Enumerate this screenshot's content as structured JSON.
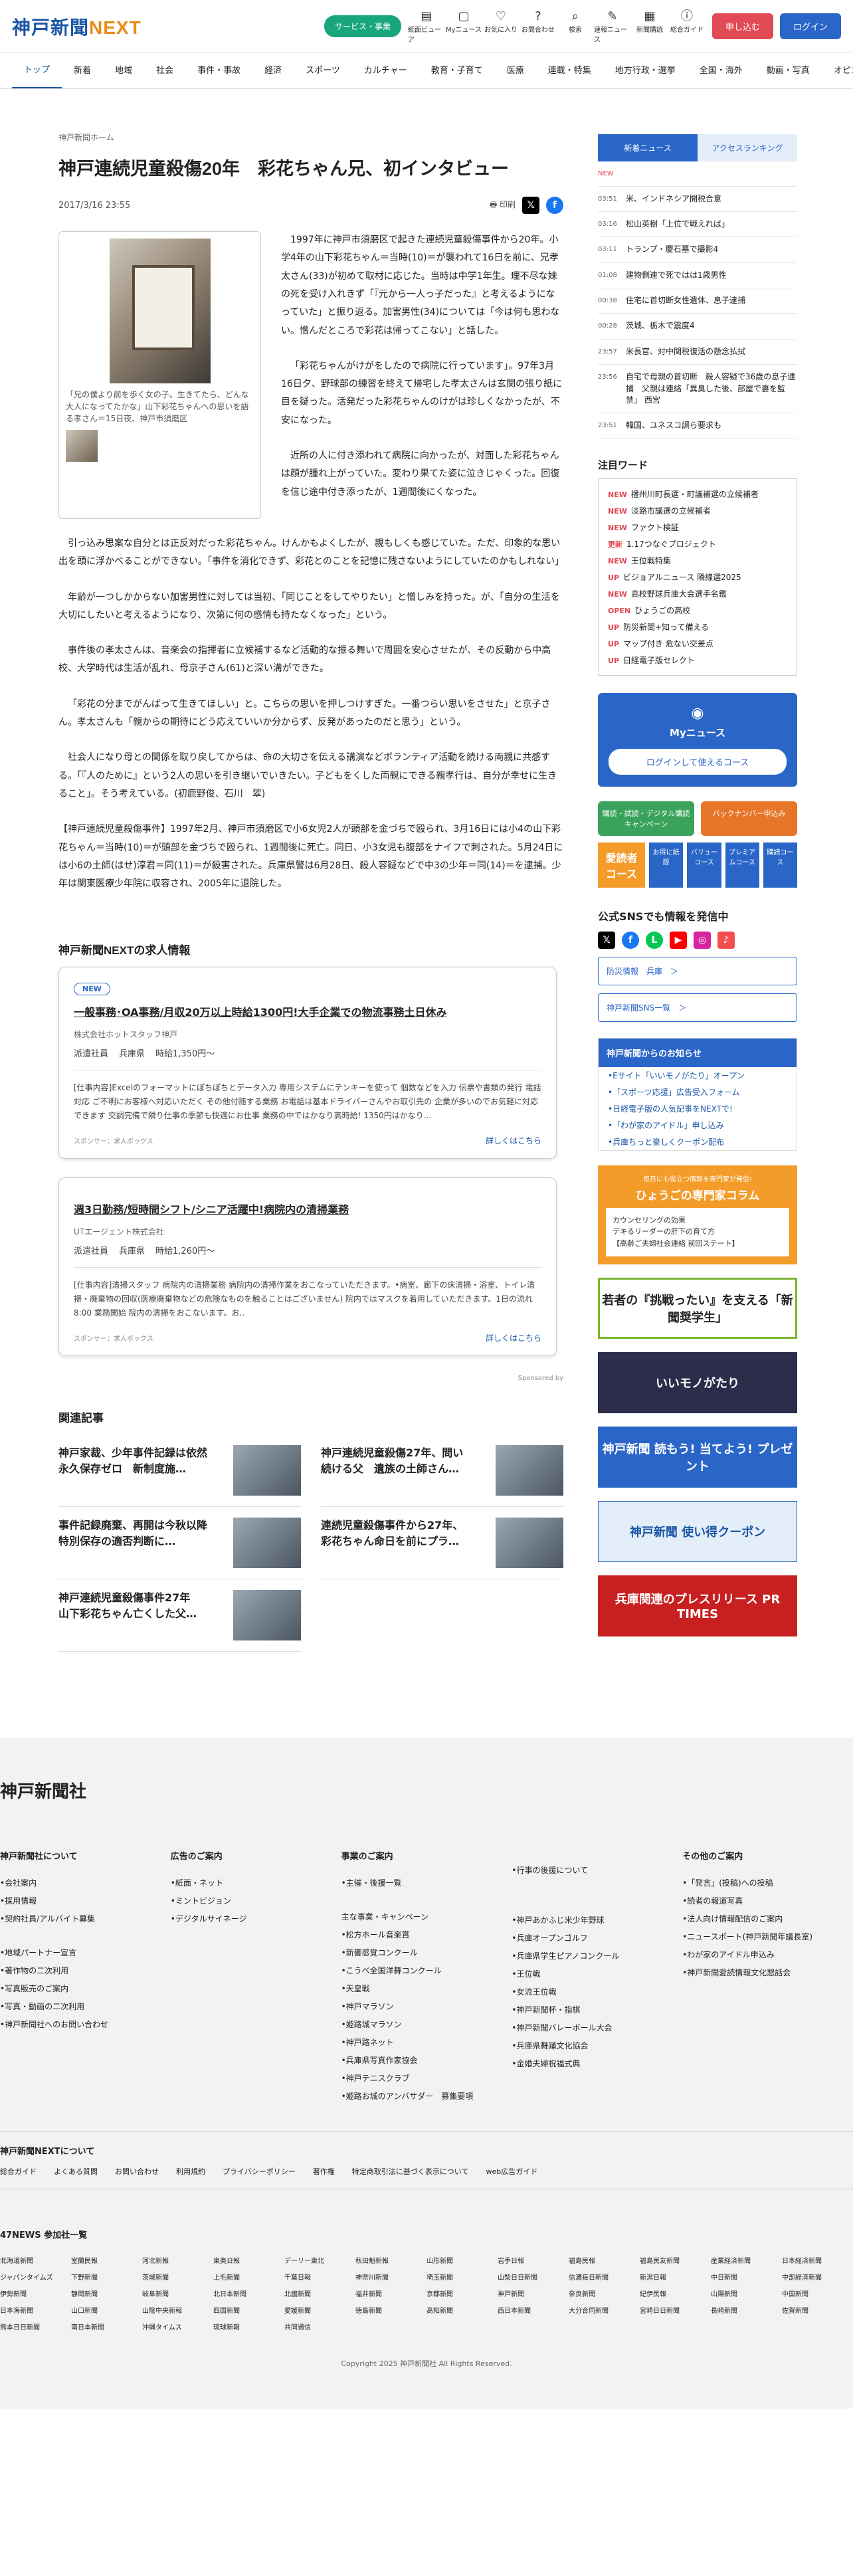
{
  "header": {
    "logo_main": "神戸新聞",
    "logo_sub": "NEXT",
    "service_btn": "サービス・事業",
    "icons": [
      {
        "label": "紙面ビューア",
        "icon": "newspaper-icon"
      },
      {
        "label": "Myニュース",
        "icon": "bookmark-icon"
      },
      {
        "label": "お気に入り",
        "icon": "heart-icon"
      },
      {
        "label": "お問合わせ",
        "icon": "help-icon"
      },
      {
        "label": "検索",
        "icon": "search-icon"
      },
      {
        "label": "速報ニュース",
        "icon": "pen-icon"
      },
      {
        "label": "新聞購読",
        "icon": "cart-icon"
      },
      {
        "label": "総合ガイド",
        "icon": "info-icon"
      }
    ],
    "signup": "申し込む",
    "login": "ログイン"
  },
  "nav": [
    "トップ",
    "新着",
    "地域",
    "社会",
    "事件・事故",
    "経済",
    "スポーツ",
    "カルチャー",
    "教育・子育て",
    "医療",
    "連載・特集",
    "地方行政・選挙",
    "全国・海外",
    "動画・写真",
    "オピニオン"
  ],
  "breadcrumb": "神戸新聞ホーム",
  "article": {
    "title": "神戸連続児童殺傷20年　彩花ちゃん兄、初インタビュー",
    "date": "2017/3/16 23:55",
    "print": "印刷",
    "caption": "「兄の僕より前を歩く女の子。生きてたら、どんな大人になってたかな」山下彩花ちゃんへの思いを語る孝さん＝15日夜、神戸市須磨区",
    "p1": "1997年に神戸市須磨区で起きた連続児童殺傷事件から20年。小学4年の山下彩花ちゃん＝当時(10)＝が襲われて16日を前に、兄孝太さん(33)が初めて取材に応じた。当時は中学1年生。理不尽な妹の死を受け入れきず「『元から一人っ子だった』と考えるようになっていた」と振り返る。加害男性(34)については「今は何も思わない。憎んだところで彩花は帰ってこない」と話した。",
    "p2": "「彩花ちゃんがけがをしたので病院に行っています」。97年3月16日夕、野球部の練習を終えて帰宅した孝太さんは玄関の張り紙に目を疑った。活発だった彩花ちゃんのけがは珍しくなかったが、不安になった。",
    "p3": "近所の人に付き添われて病院に向かったが、対面した彩花ちゃんは顔が腫れ上がっていた。変わり果てた姿に泣きじゃくった。回復を信じ途中付き添ったが、1週間後にくなった。",
    "p4": "引っ込み思案な自分とは正反対だった彩花ちゃん。けんかもよくしたが、親もしくも感じていた。ただ、印象的な思い出を頭に浮かべることができない。「事件を消化できず、彩花とのことを記憶に残さないようにしていたのかもしれない」",
    "p5": "年齢が一つしかからない加害男性に対しては当初、「同じことをしてやりたい」と憎しみを持った。が、「自分の生活を大切にしたいと考えるようになり、次第に何の感情も持たなくなった」という。",
    "p6": "事件後の孝太さんは、音楽会の指揮者に立候補するなど活動的な振る舞いで周囲を安心させたが、その反動から中高校、大学時代は生活が乱れ、母京子さん(61)と深い溝ができた。",
    "p7": "「彩花の分までがんばって生きてほしい」と。こちらの思いを押しつけすぎた。一番つらい思いをさせた」と京子さん。孝太さんも「親からの期待にどう応えていいか分からず、反発があったのだと思う」という。",
    "p8": "社会人になり母との関係を取り戻してからは、命の大切さを伝える講演などボランティア活動を続ける両親に共感する。「『人のために』という2人の思いを引き継いでいきたい。子どもをくした両親にできる親孝行は、自分が幸せに生きること」。そう考えている。(初鹿野俊、石川　翠)",
    "p9": "【神戸連続児童殺傷事件】1997年2月、神戸市須磨区で小6女児2人が頭部を金づちで殴られ、3月16日には小4の山下彩花ちゃん＝当時(10)＝が頭部を金づちで殴られ、1週間後に死亡。同日、小3女児も腹部をナイフで刺された。5月24日には小6の土師(はせ)淳君＝同(11)＝が殺害された。兵庫県警は6月28日、殺人容疑などで中3の少年＝同(14)＝を逮捕。少年は関東医療少年院に収容され、2005年に退院した。"
  },
  "jobs": {
    "heading": "神戸新聞NEXTの求人情報",
    "items": [
      {
        "badge": "NEW",
        "title": "一般事務･OA事務/月収20万以上時給1300円!大手企業での物流事務土日休み",
        "company": "株式会社ホットスタッフ神戸",
        "type": "派遣社員",
        "area": "兵庫県",
        "pay": "時給1,350円〜",
        "desc": "[仕事内容]Excelのフォーマットにぽちぽちとデータ入力 専用システムにテンキーを使って 個数などを入力 伝票や書類の発行 電話対応 ご不明にお客様へ対応いただく その他付随する業務 お電話は基本ドライバーさんやお取引先の 企業が多いのでお気軽に対応できます 交調完備で隣り仕事の季節も快適にお仕事 業務の中ではかなり高時給! 1350円はかなり...",
        "sponsor": "スポンサー：求人ボックス",
        "more": "詳しくはこちら"
      },
      {
        "badge": "",
        "title": "週3日勤務/短時間シフト/シニア活躍中!病院内の清掃業務",
        "company": "UTエージェント株式会社",
        "type": "派遣社員",
        "area": "兵庫県",
        "pay": "時給1,260円〜",
        "desc": "[仕事内容]清掃スタッフ 病院内の清掃業務 病院内の清掃作業をおこなっていただきます。•病室、廊下の床清掃・浴室、トイレ清掃・廃棄物の回収(医療廃棄物などの危険なものを触ることはございません) 院内ではマスクを着用していただきます。1日の流れ 8:00 業務開始 院内の清掃をおこないます。お..",
        "sponsor": "スポンサー：求人ボックス",
        "more": "詳しくはこちら"
      }
    ],
    "sponsored": "Sponsored by"
  },
  "related": {
    "heading": "関連記事",
    "items": [
      "神戸家裁、少年事件記録は依然永久保存ゼロ　新制度施…",
      "神戸連続児童殺傷27年、問い続ける父　遺族の土師さん…",
      "事件記録廃棄、再開は今秋以降　特別保存の適否判断に…",
      "連続児童殺傷事件から27年、彩花ちゃん命日を前にプラ…",
      "神戸連続児童殺傷事件27年　山下彩花ちゃん亡くした父…"
    ]
  },
  "sidebar": {
    "tab_new": "新着ニュース",
    "tab_rank": "アクセスランキング",
    "news": [
      {
        "time": "NEW",
        "text": ""
      },
      {
        "time": "03:51",
        "text": "米、インドネシア開税合意"
      },
      {
        "time": "03:16",
        "text": "松山英樹「上位で戦えれば」"
      },
      {
        "time": "03:11",
        "text": "トランプ・慶石墓で撮影4"
      },
      {
        "time": "01:08",
        "text": "建物側連で死ではは1歳男性"
      },
      {
        "time": "00:38",
        "text": "住宅に首切断女性遺体、息子逮捕"
      },
      {
        "time": "00:28",
        "text": "茨城、栃木で震度4"
      },
      {
        "time": "23:57",
        "text": "米長官、対中関税復活の懸念払拭"
      },
      {
        "time": "23:56",
        "text": "自宅で母親の首切断　殺人容疑で36歳の息子逮捕　父親は連絡「異臭した後、部屋で妻を監禁」 西宮"
      },
      {
        "time": "23:51",
        "text": "韓国、ユネスコ調ら要求も"
      }
    ],
    "attn_heading": "注目ワード",
    "attn": [
      {
        "k": "NEW",
        "t": "播州川町長選・町議補選の立候補者"
      },
      {
        "k": "NEW",
        "t": "淡路市議選の立候補者"
      },
      {
        "k": "NEW",
        "t": "ファクト検証"
      },
      {
        "k": "更新",
        "t": "1.17つなぐプロジェクト"
      },
      {
        "k": "NEW",
        "t": "王位戦特集"
      },
      {
        "k": "UP",
        "t": "ビジョアルニュース 隣線選2025"
      },
      {
        "k": "NEW",
        "t": "高校野球兵庫大会選手名鑑"
      },
      {
        "k": "OPEN",
        "t": "ひょうごの高校"
      },
      {
        "k": "UP",
        "t": "防災新聞+知って備える"
      },
      {
        "k": "UP",
        "t": "マップ付き 危ない交差点"
      },
      {
        "k": "UP",
        "t": "日経電子版セレクト"
      }
    ],
    "my_title": "Myニュース",
    "my_btn": "ログインして使えるコース",
    "pill1": "購読・試読・デジタル購読キャンペーン",
    "pill2": "バックナンバー申込み",
    "digital": "デジタル",
    "digi_o": "愛読者コース",
    "digi_b": [
      "お得に紙版",
      "バリューコース",
      "プレミアムコース",
      "購読コース"
    ],
    "sns_heading": "公式SNSでも情報を発信中",
    "sns_link1": "防災情報　兵庫　＞",
    "sns_link2": "神戸新聞SNS一覧　＞",
    "info_heading": "神戸新聞からのお知らせ",
    "info": [
      "•Eサイト「いいモノがたり」オープン",
      "•「スポーツ応援」広告受入フォーム",
      "•日経電子版の人気記事をNEXTで!",
      "•「わが家のアイドル」申し込み",
      "•兵庫ちっと豪しくクーポン配布"
    ],
    "col_title": "ひょうごの専門家コラム",
    "col_sub": "毎日にも役立つ情報を専門家が発信!",
    "col_items": [
      "カウンセリングの効果",
      "デキるリーダーの肝下の育て方",
      "【高齢ご夫婦社会連絡 前回ステート】"
    ],
    "banners": [
      "若者の『挑戦ったい』を支える「新聞奨学生」",
      "いいモノがたり",
      "神戸新聞 読もう! 当てよう! プレゼント",
      "神戸新聞 使い得クーポン",
      "兵庫関連のプレスリリース PR TIMES"
    ]
  },
  "footer": {
    "logo": "神戸新聞社",
    "cols": [
      {
        "h": "神戸新聞社について",
        "items": [
          "•会社案内",
          "•採用情報",
          "•契約社員/アルバイト募集",
          "",
          "•地域パートナー宣言",
          "•著作物の二次利用",
          "•写真販売のご案内",
          "•写真・動画の二次利用",
          "•神戸新聞社へのお問い合わせ"
        ]
      },
      {
        "h": "広告のご案内",
        "items": [
          "•紙面・ネット",
          "•ミントビジョン",
          "•デジタルサイネージ"
        ]
      },
      {
        "h": "事業のご案内",
        "items": [
          "•主催・後援一覧",
          "",
          "主な事業・キャンペーン",
          "•松方ホール音楽賞",
          "•新響感覚コンクール",
          "•こうべ全国洋舞コンクール",
          "•天皇戦",
          "•神戸マラソン",
          "•姫路城マラソン",
          "•神戸路ネット",
          "•兵庫県写真作家協会",
          "•神戸テニスクラブ",
          "•姫路お城のアンバサダー　募集要項"
        ]
      },
      {
        "h": "",
        "items": [
          "•行事の後援について",
          "",
          "",
          "•神戸あかふじ米少年野球",
          "•兵庫オープンゴルフ",
          "•兵庫県学生ピアノコンクール",
          "•王位戦",
          "•女流王位戦",
          "•神戸新聞杯・指棋",
          "•神戸新聞バレーボール大会",
          "•兵庫県舞踊文化協会",
          "•金婚夫婦祝福式典"
        ]
      },
      {
        "h": "その他のご案内",
        "items": [
          "•「発言」(投稿)への投稿",
          "•読者の報道写真",
          "•法人向け情報配信のご案内",
          "•ニュースポート(神戸新聞年議長室)",
          "•わが家のアイドル申込み",
          "•神戸新聞愛読情報文化懇話会"
        ]
      }
    ],
    "next_about": "神戸新聞NEXTについて",
    "links": [
      "総合ガイド",
      "よくある質問",
      "お問い合わせ",
      "利用規約",
      "プライバシーポリシー",
      "著作権",
      "特定商取引法に基づく表示について",
      "web広告ガイド"
    ],
    "n47_heading": "47NEWS 参加社一覧",
    "n47": [
      "北海道新聞",
      "室蘭民報",
      "河北新報",
      "東奥日報",
      "デーリー東北",
      "秋田魁新報",
      "山形新聞",
      "岩手日報",
      "福島民報",
      "福島民友新聞",
      "産業経済新聞",
      "日本経済新聞",
      "ジャパンタイムズ",
      "下野新聞",
      "茨城新聞",
      "上毛新聞",
      "千葉日報",
      "神奈川新聞",
      "埼玉新聞",
      "山梨日日新聞",
      "信濃毎日新聞",
      "新潟日報",
      "中日新聞",
      "中部経済新聞",
      "伊勢新聞",
      "静岡新聞",
      "岐阜新聞",
      "北日本新聞",
      "北國新聞",
      "福井新聞",
      "京都新聞",
      "神戸新聞",
      "奈良新聞",
      "紀伊民報",
      "山陽新聞",
      "中国新聞",
      "日本海新聞",
      "山口新聞",
      "山陰中央新報",
      "四国新聞",
      "愛媛新聞",
      "徳島新聞",
      "高知新聞",
      "西日本新聞",
      "大分合同新聞",
      "宮崎日日新聞",
      "長崎新聞",
      "佐賀新聞",
      "熊本日日新聞",
      "南日本新聞",
      "沖縄タイムス",
      "琉球新報",
      "共同通信"
    ],
    "copyright": "Copyright 2025 神戸新聞社 All Rights Reserved."
  }
}
